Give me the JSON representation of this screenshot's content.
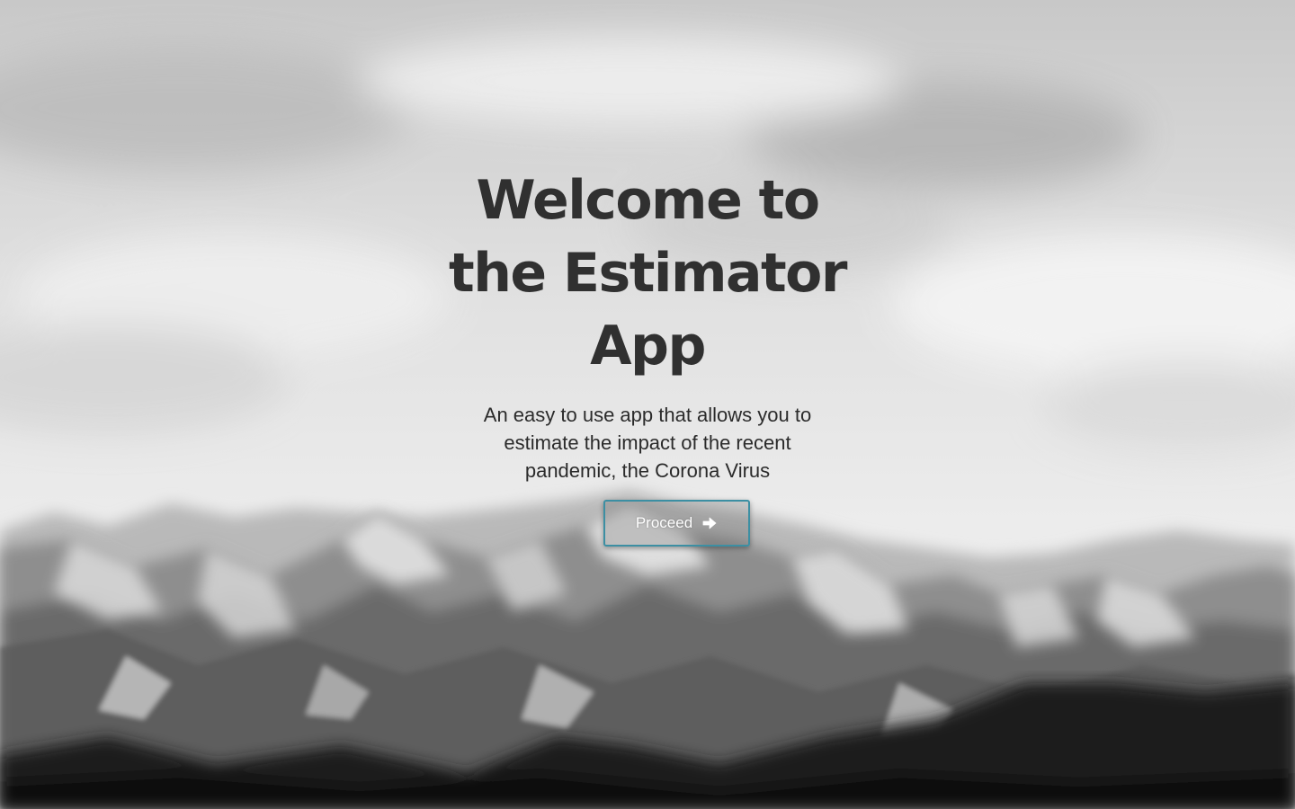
{
  "hero": {
    "title_lines": [
      "Welcome to",
      "the Estimator",
      "App"
    ],
    "subtitle_lines": [
      "An easy to use app that allows you to",
      "estimate the impact of the recent",
      "pandemic, the Corona Virus"
    ],
    "button_label": "Proceed",
    "button_icon": "arrow-right-icon",
    "button_border_color": "#3c8fa3"
  },
  "background": {
    "description_icon": "mountain-landscape-icon"
  }
}
